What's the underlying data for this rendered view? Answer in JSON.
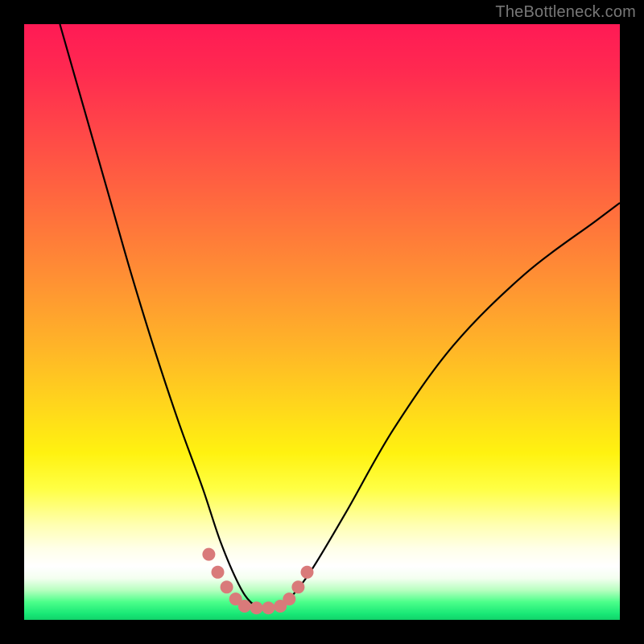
{
  "watermark": "TheBottleneck.com",
  "colors": {
    "frame": "#000000",
    "curve": "#000000",
    "beads": "#d97a7a"
  },
  "chart_data": {
    "type": "line",
    "title": "",
    "xlabel": "",
    "ylabel": "",
    "xlim": [
      0,
      100
    ],
    "ylim": [
      0,
      100
    ],
    "grid": false,
    "legend": false,
    "note": "Axes are unlabeled in the source image; x/y are normalized 0–100 across the plot area. y=0 is the bottom (green) edge, y=100 is the top (red) edge. The curve descends steeply from top-left, bottoms out along the green band around x≈36–44, then rises toward the right.",
    "series": [
      {
        "name": "curve",
        "x": [
          6,
          10,
          14,
          18,
          22,
          26,
          30,
          33,
          36,
          38,
          40,
          42,
          44,
          48,
          54,
          62,
          72,
          84,
          96,
          100
        ],
        "y": [
          100,
          86,
          72,
          58,
          45,
          33,
          22,
          13,
          6,
          3,
          2,
          2,
          3,
          8,
          18,
          32,
          46,
          58,
          67,
          70
        ]
      }
    ],
    "beads": {
      "note": "short segment of thick salmon dots hugging the bottom of the V",
      "x": [
        31,
        32.5,
        34,
        35.5,
        37,
        39,
        41,
        43,
        44.5,
        46,
        47.5
      ],
      "y": [
        11,
        8,
        5.5,
        3.5,
        2.3,
        2,
        2,
        2.3,
        3.5,
        5.5,
        8
      ]
    }
  }
}
